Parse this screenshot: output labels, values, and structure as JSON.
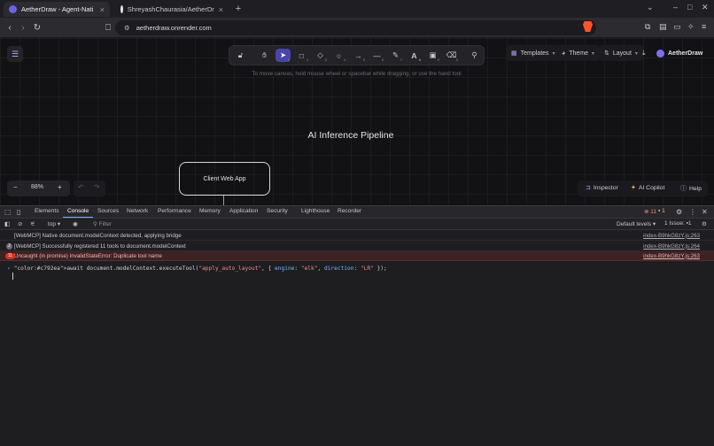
{
  "browser": {
    "tabs": [
      {
        "title": "AetherDraw - Agent-Nati",
        "active": true
      },
      {
        "title": "ShreyashChaurasia/AetherDr",
        "active": false
      }
    ],
    "new_tab": "+",
    "url": "aetherdraw.onrender.com"
  },
  "app": {
    "menu_icon": "hamburger-icon",
    "tools": [
      {
        "name": "lock-icon",
        "key": "",
        "selected": false
      },
      {
        "name": "hand-icon",
        "key": "",
        "selected": false
      },
      {
        "name": "pointer-icon",
        "key": "1",
        "selected": true
      },
      {
        "name": "rectangle-icon",
        "key": "2",
        "selected": false
      },
      {
        "name": "diamond-icon",
        "key": "3",
        "selected": false
      },
      {
        "name": "ellipse-icon",
        "key": "4",
        "selected": false
      },
      {
        "name": "arrow-icon",
        "key": "5",
        "selected": false
      },
      {
        "name": "line-icon",
        "key": "6",
        "selected": false
      },
      {
        "name": "pencil-icon",
        "key": "7",
        "selected": false
      },
      {
        "name": "text-icon",
        "key": "8",
        "selected": false
      },
      {
        "name": "image-icon",
        "key": "9",
        "selected": false
      },
      {
        "name": "eraser-icon",
        "key": "0",
        "selected": false
      },
      {
        "name": "shapes-icon",
        "key": "",
        "selected": false
      }
    ],
    "hint": "To move canvas, hold mouse wheel or spacebar while dragging, or use the hand tool",
    "templates_label": "Templates",
    "theme_label": "Theme",
    "layout_label": "Layout",
    "brand": "AetherDraw",
    "diagram_title": "AI Inference Pipeline",
    "node_label": "Client Web App",
    "zoom": "88%",
    "zoom_out": "−",
    "zoom_in": "+",
    "inspector_label": "Inspector",
    "copilot_label": "AI Copilot",
    "help_label": "Help",
    "accent": "#4a45a8"
  },
  "devtools": {
    "tabs": [
      "Elements",
      "Console",
      "Sources",
      "Network",
      "Performance",
      "Memory",
      "Application",
      "Security",
      "Lighthouse",
      "Recorder"
    ],
    "active_tab": "Console",
    "error_count": "11",
    "warning_count": "1",
    "context": "top",
    "filter_placeholder": "Filter",
    "levels": "Default levels",
    "issues": "1 Issue:",
    "issues_count": "1",
    "logs": [
      {
        "text": "[WebMCP] Native document.modelContext detected, applying bridge",
        "source": "index-B9hkG8zY.js:263",
        "level": "info",
        "badge": ""
      },
      {
        "text": "[WebMCP] Successfully registered 11 tools to document.modelContext",
        "source": "index-B9hkG8zY.js:264",
        "level": "info",
        "badge": "2"
      },
      {
        "text": "Uncaught (in promise) InvalidStateError: Duplicate tool name",
        "source": "index-B9hkG8zY.js:263",
        "level": "error",
        "badge": "11"
      }
    ],
    "prompt": "await document.modelContext.executeTool(\"apply_auto_layout\", { engine: \"elk\", direction: \"LR\" });"
  }
}
